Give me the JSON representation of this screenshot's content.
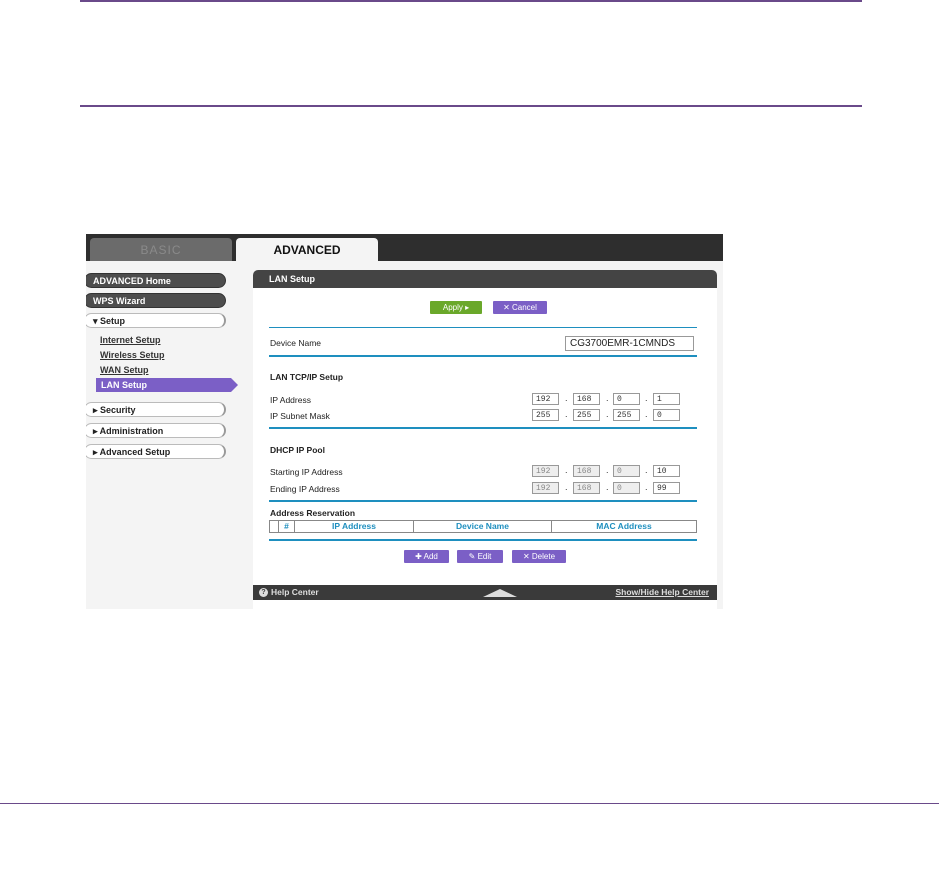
{
  "tabs": {
    "basic": "BASIC",
    "advanced": "ADVANCED"
  },
  "sidebar": {
    "advanced_home": "ADVANCED Home",
    "wps_wizard": "WPS Wizard",
    "setup": "▾ Setup",
    "setup_items": [
      "Internet Setup",
      "Wireless Setup",
      "WAN Setup",
      "LAN Setup"
    ],
    "security": "▸ Security",
    "administration": "▸ Administration",
    "advanced_setup": "▸ Advanced Setup"
  },
  "panel": {
    "title": "LAN Setup",
    "apply": "Apply ▸",
    "cancel": "✕ Cancel",
    "device_name_label": "Device Name",
    "device_name_value": "CG3700EMR-1CMNDS",
    "tcpip_section": "LAN TCP/IP Setup",
    "ip_address_label": "IP Address",
    "ip_address": [
      "192",
      "168",
      "0",
      "1"
    ],
    "subnet_label": "IP Subnet Mask",
    "subnet": [
      "255",
      "255",
      "255",
      "0"
    ],
    "dhcp_section": "DHCP IP Pool",
    "start_label": "Starting IP Address",
    "start_ip": [
      "192",
      "168",
      "0",
      "10"
    ],
    "end_label": "Ending IP Address",
    "end_ip": [
      "192",
      "168",
      "0",
      "99"
    ],
    "reservation_section": "Address Reservation",
    "table_headers": [
      "#",
      "IP Address",
      "Device Name",
      "MAC Address"
    ],
    "add": "✚ Add",
    "edit": "✎ Edit",
    "delete": "✕ Delete"
  },
  "footer": {
    "help_center": "Help Center",
    "show_hide": "Show/Hide Help Center"
  },
  "colors": {
    "accent": "#7b5fc6",
    "apply_green": "#6aa82a",
    "section_blue": "#1e8fbf",
    "rule_purple": "#6a4a8a"
  }
}
